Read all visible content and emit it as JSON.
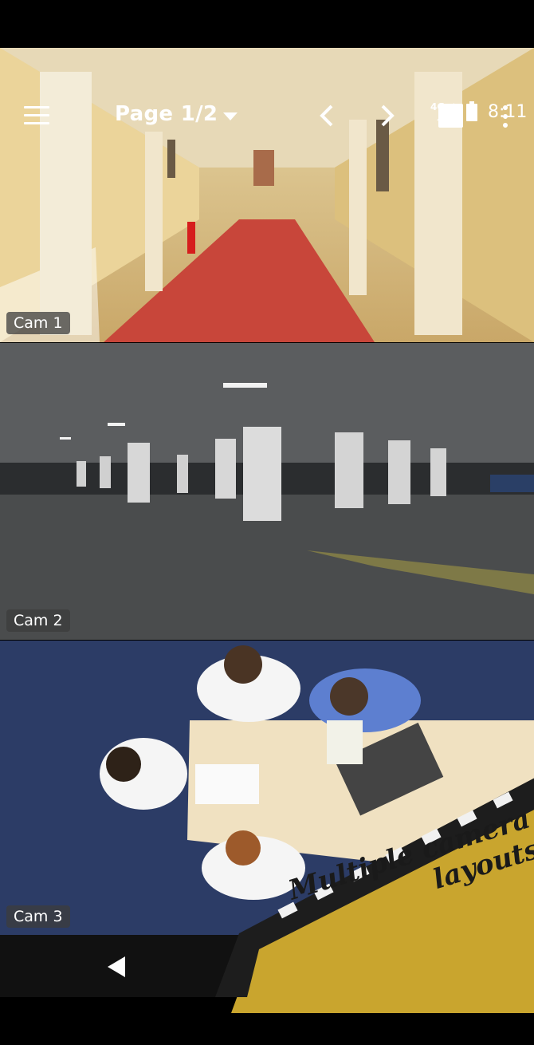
{
  "status_bar": {
    "network": "4G",
    "time": "8:11"
  },
  "toolbar": {
    "page_label": "Page 1/2"
  },
  "cameras": [
    {
      "label": "Cam 1"
    },
    {
      "label": "Cam 2"
    },
    {
      "label": "Cam 3"
    }
  ],
  "promo": {
    "line1": "Multiple camera",
    "line2": "layouts"
  },
  "icons": {
    "menu": "hamburger-menu-icon",
    "dropdown": "chevron-down-icon",
    "prev": "chevron-left-icon",
    "next": "chevron-right-icon",
    "stop": "stop-square-icon",
    "more": "more-vertical-icon",
    "back": "nav-back-icon",
    "signal": "signal-icon",
    "battery": "battery-icon"
  },
  "colors": {
    "banner": "#c9a52e",
    "film_strip": "#1d1d1d"
  }
}
